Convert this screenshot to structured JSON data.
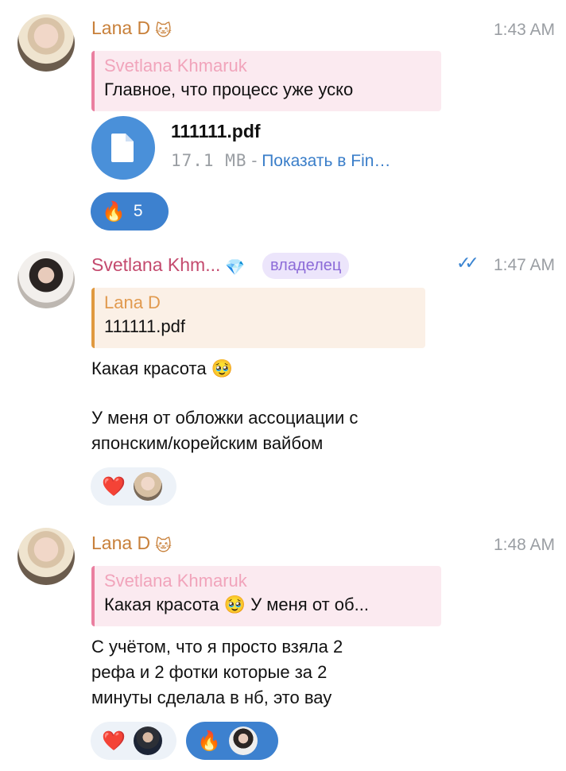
{
  "messages": [
    {
      "author": "Lana D",
      "author_emoji": "🐱",
      "time": "1:43 AM",
      "reply": {
        "name": "Svetlana Khmaruk",
        "text": "Главное, что процесс уже уско"
      },
      "file": {
        "name": "111111.pdf",
        "size": "17.1 MB",
        "separator": " - ",
        "action": "Показать в Fin…"
      },
      "reactions": [
        {
          "emoji": "🔥",
          "count": "5"
        }
      ]
    },
    {
      "author": "Svetlana Khm...",
      "author_emoji": "💎",
      "role": "владелец",
      "time": "1:47 AM",
      "reply": {
        "name": "Lana D",
        "text": "111111.pdf"
      },
      "text_line1": "Какая красота 🥹",
      "text_line2": "У меня от обложки ассоциации с",
      "text_line3": "японским/корейским вайбом",
      "reactions": [
        {
          "emoji": "❤️"
        }
      ]
    },
    {
      "author": "Lana D",
      "author_emoji": "🐱",
      "time": "1:48 AM",
      "reply": {
        "name": "Svetlana Khmaruk",
        "text": "Какая красота 🥹  У меня от об..."
      },
      "text_line1": "С учётом, что я просто взяла 2",
      "text_line2": "рефа и 2 фотки которые за 2",
      "text_line3": "минуты сделала в нб, это вау",
      "reactions": [
        {
          "emoji": "❤️"
        },
        {
          "emoji": "🔥"
        }
      ]
    }
  ],
  "icons": {
    "file": "document-icon",
    "read": "double-check-icon"
  },
  "colors": {
    "lana": "#c8803a",
    "svetlana": "#c44a6e",
    "accent": "#3d81cf"
  }
}
